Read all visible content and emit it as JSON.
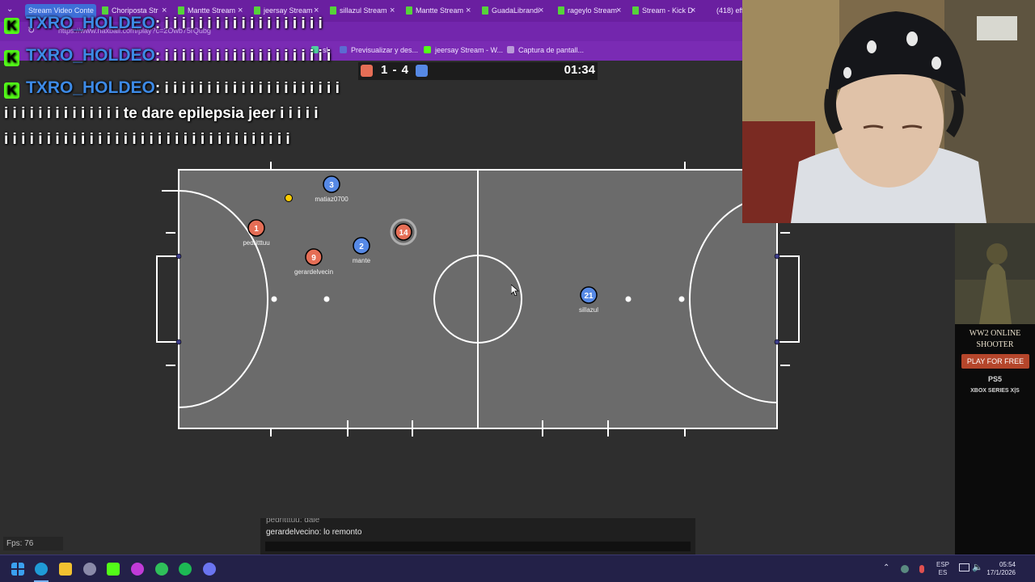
{
  "browser": {
    "tabs": [
      {
        "label": "Stream Video Conte",
        "active": true
      },
      {
        "label": "Choriposta Str",
        "active": false
      },
      {
        "label": "Mantte Stream",
        "active": false
      },
      {
        "label": "jeersay Stream",
        "active": false
      },
      {
        "label": "sillazul Stream",
        "active": false
      },
      {
        "label": "Mantte Stream",
        "active": false
      },
      {
        "label": "GuadaLibrandi",
        "active": false
      },
      {
        "label": "rageylo Stream",
        "active": false
      },
      {
        "label": "Stream - Kick D",
        "active": false
      },
      {
        "label": "(418) eff",
        "active": false
      }
    ],
    "url": "https://www.haxball.com/play?c=2Owb75rQubg",
    "bookmarks": [
      "sl",
      "Previsualizar y des...",
      "jeersay Stream - W...",
      "Captura de pantall..."
    ]
  },
  "scoreboard": {
    "score": "1 - 4",
    "timer": "01:34",
    "red_color": "#e56e56",
    "blue_color": "#5689e5"
  },
  "stream_chat": {
    "lines": [
      {
        "user": "TXRO_HOLDEO",
        "message": ": i i i i i i i i i i i i i i i i i i i"
      },
      {
        "user": "TXRO_HOLDEO",
        "message": ": i i i i i i i i i i i i i i i i i i i i"
      },
      {
        "user": "TXRO_HOLDEO",
        "message": ": i i i i i i i i i i i i i i i i i i i i i"
      }
    ],
    "cont1": "i i i i i i i i i i i i i i te dare epilepsia jeer i i i i i",
    "cont2": "i i i i i i i i i i i i i i i i i i i i i i i i i i i i i i i i i i"
  },
  "players": [
    {
      "number": "3",
      "name": "matiaz0700",
      "team": "blue"
    },
    {
      "number": "1",
      "name": "pedritttuu",
      "team": "red"
    },
    {
      "number": "2",
      "name": "mante",
      "team": "blue"
    },
    {
      "number": "9",
      "name": "gerardelvecin",
      "team": "red"
    },
    {
      "number": "14",
      "name": "",
      "team": "red"
    },
    {
      "number": "21",
      "name": "sillazul",
      "team": "blue"
    }
  ],
  "ad": {
    "title_1": "WW2 ONLINE",
    "title_2": "SHOOTER",
    "button": "PLAY FOR FREE",
    "platform_1": "PS5",
    "platform_2": "XBOX SERIES X|S"
  },
  "game_chat": {
    "previous": "pedritttuu: dale",
    "message": "gerardelvecino: lo remonto"
  },
  "fps": "Fps: 76",
  "taskbar": {
    "lang_1": "ESP",
    "lang_2": "ES",
    "time": "05:54",
    "date": "17/1/2026"
  }
}
